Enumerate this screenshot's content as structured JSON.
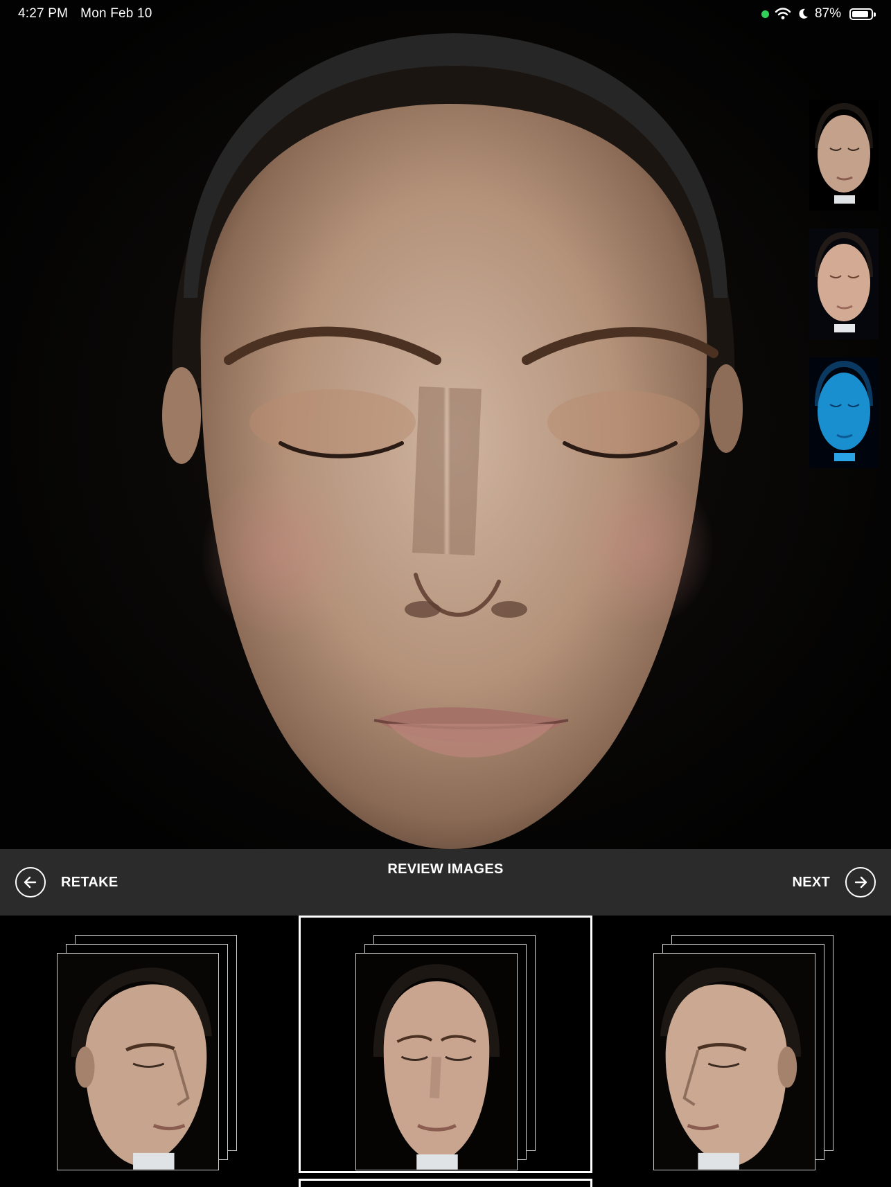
{
  "status_bar": {
    "time": "4:27 PM",
    "date": "Mon Feb 10",
    "battery": "87%",
    "battery_level": 0.87,
    "icons": [
      "camera-in-use-dot",
      "wifi-icon",
      "focus-moon-icon",
      "battery-icon"
    ]
  },
  "main_image": {
    "subject": "face-front-eyes-closed"
  },
  "side_thumbnails": [
    {
      "view": "standard-light"
    },
    {
      "view": "cross-polarized"
    },
    {
      "view": "uv-light",
      "tint": "#1a8fd0"
    }
  ],
  "control_bar": {
    "title": "REVIEW IMAGES",
    "retake_label": "RETAKE",
    "next_label": "NEXT",
    "retake_icon": "arrow-left-circle-icon",
    "next_icon": "arrow-right-circle-icon",
    "background": "#2b2b2b"
  },
  "bottom_strip": {
    "stacks": [
      {
        "view": "left-profile",
        "selected": false
      },
      {
        "view": "front",
        "selected": true
      },
      {
        "view": "right-profile",
        "selected": false
      }
    ],
    "selected_index": 1
  }
}
